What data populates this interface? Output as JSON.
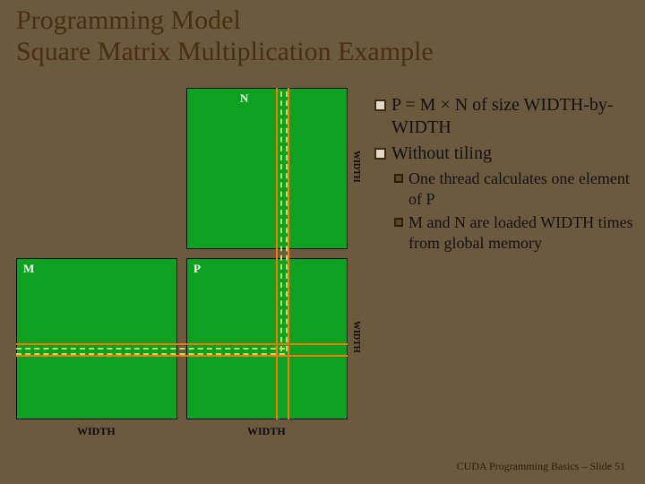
{
  "title_line1": "Programming Model",
  "title_line2": "Square Matrix Multiplication Example",
  "matrices": {
    "n": "N",
    "m": "M",
    "p": "P"
  },
  "width_label": "WIDTH",
  "bullets": {
    "b1": "P = M × N of size WIDTH-by-WIDTH",
    "b2": "Without tiling",
    "s1": "One thread calculates one element of P",
    "s2": "M and N are loaded WIDTH times from global memory"
  },
  "footer": "CUDA Programming Basics – Slide  51"
}
